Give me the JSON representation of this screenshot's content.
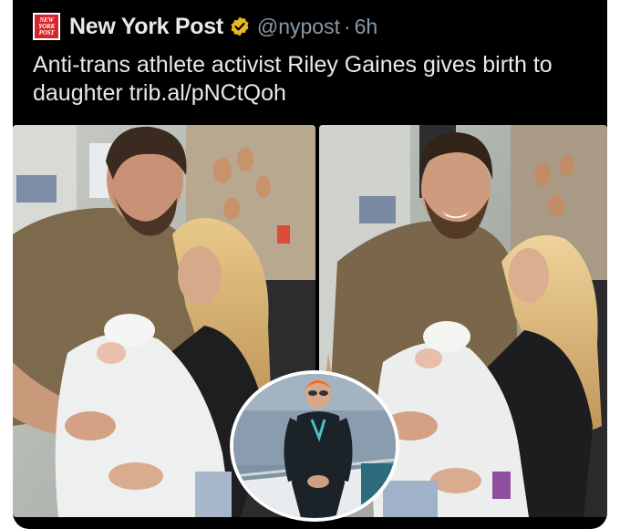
{
  "post": {
    "account_name": "New York Post",
    "logo_lines": [
      "NEW",
      "YORK",
      "POST"
    ],
    "handle": "@nypost",
    "separator": "·",
    "time": "6h",
    "verified_icon": "verified-badge-icon",
    "text": "Anti-trans athlete activist Riley Gaines gives birth to daughter trib.al/pNCtQoh"
  },
  "colors": {
    "background": "#000000",
    "text": "#e7e9ea",
    "muted": "#8b98a5",
    "brand_red": "#d7262b",
    "badge_gold": "#e8b923"
  }
}
